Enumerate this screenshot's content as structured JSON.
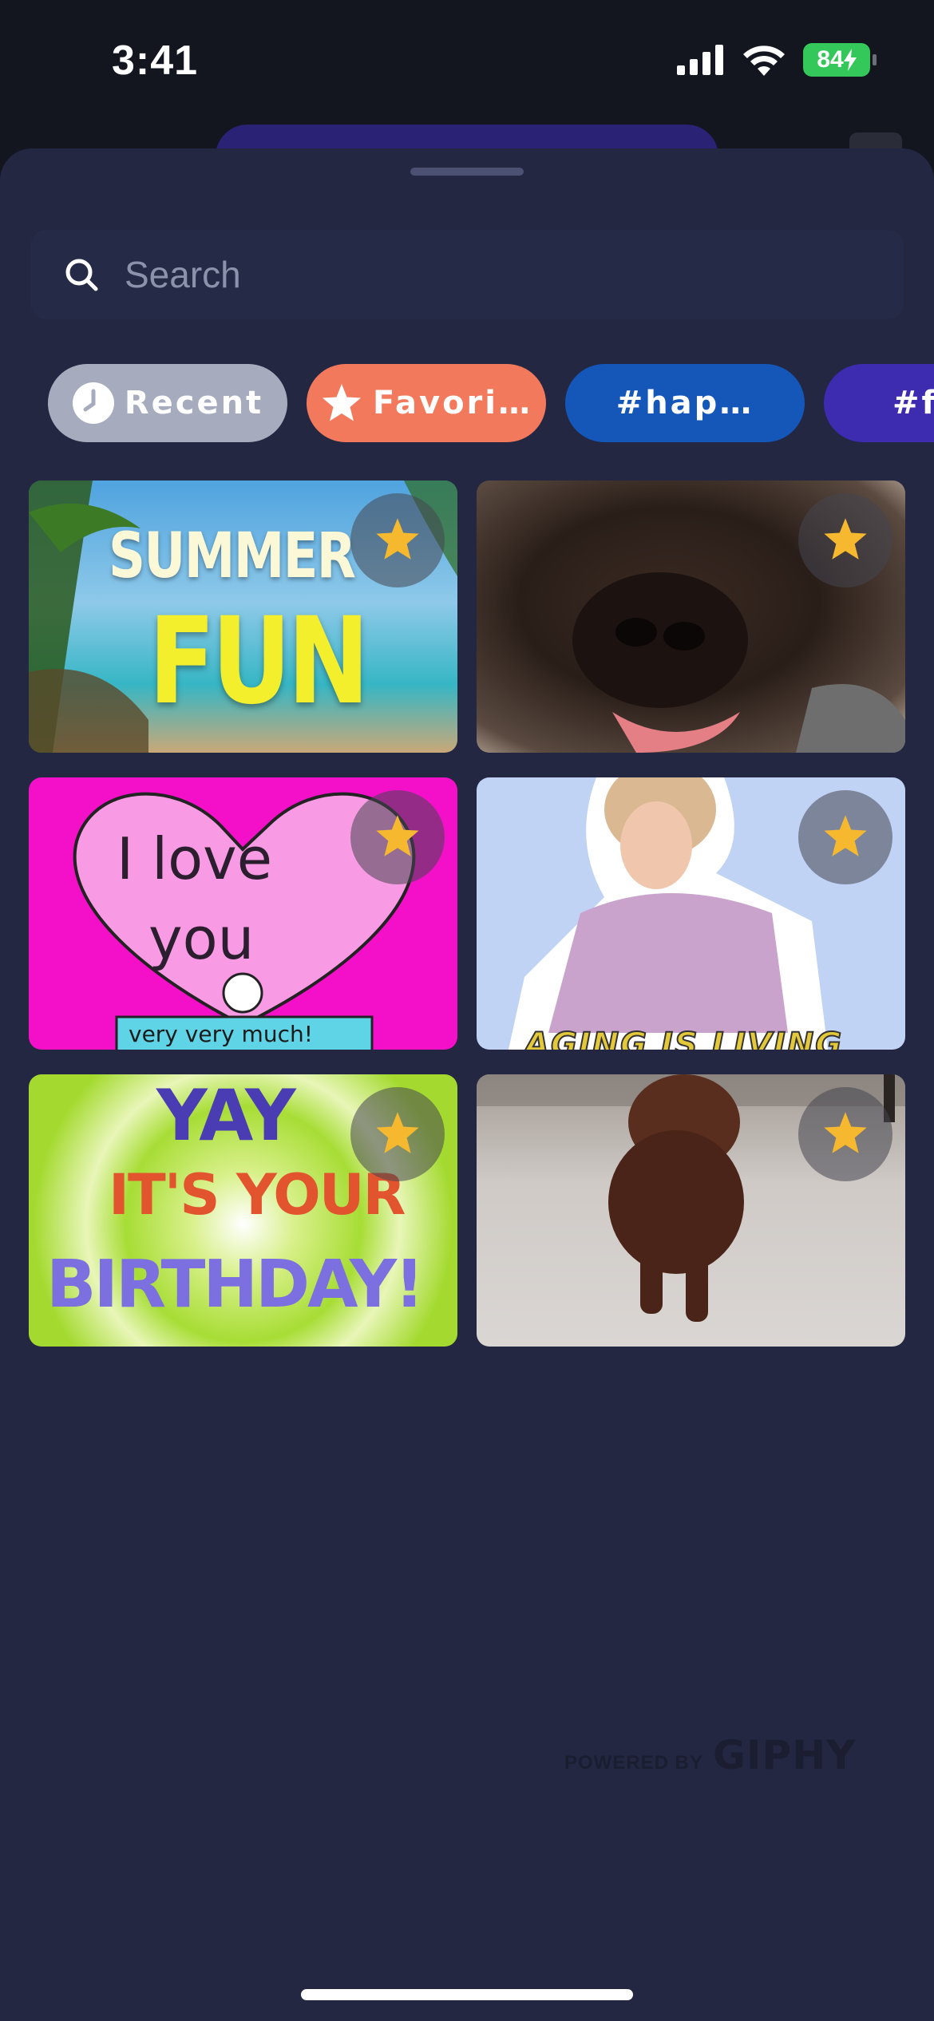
{
  "status_bar": {
    "time": "3:41",
    "battery_level": "84",
    "battery_color": "#34c759",
    "icons": [
      "cellular-signal-icon",
      "wifi-icon",
      "battery-charging-icon"
    ]
  },
  "search": {
    "placeholder": "Search",
    "value": ""
  },
  "tabs": [
    {
      "label": "Recent",
      "icon": "clock-icon",
      "color": "#a6acbd"
    },
    {
      "label": "Favori…",
      "icon": "star-icon",
      "color": "#f2795b"
    },
    {
      "label": "#hap…",
      "icon": "",
      "color": "#1457b9"
    },
    {
      "label": "#f",
      "icon": "",
      "color": "#3d2bb0"
    }
  ],
  "gifs": [
    {
      "text_top": "SUMMER",
      "text_bottom": "FUN",
      "favorite_icon": "star-icon"
    },
    {
      "favorite_icon": "star-icon"
    },
    {
      "text_top": "I love",
      "text_middle": "you",
      "text_bottom": "very very much!",
      "favorite_icon": "star-icon"
    },
    {
      "text_bottom": "AGING IS LIVING",
      "favorite_icon": "star-icon"
    },
    {
      "text_top": "YAY",
      "text_middle": "IT'S YOUR",
      "text_bottom": "BIRTHDAY!",
      "favorite_icon": "star-icon"
    },
    {
      "favorite_icon": "star-icon"
    }
  ],
  "attribution": {
    "powered_by": "POWERED BY",
    "brand": "GIPHY"
  },
  "colors": {
    "sheet_bg": "#232742",
    "star": "#f5b82e"
  }
}
